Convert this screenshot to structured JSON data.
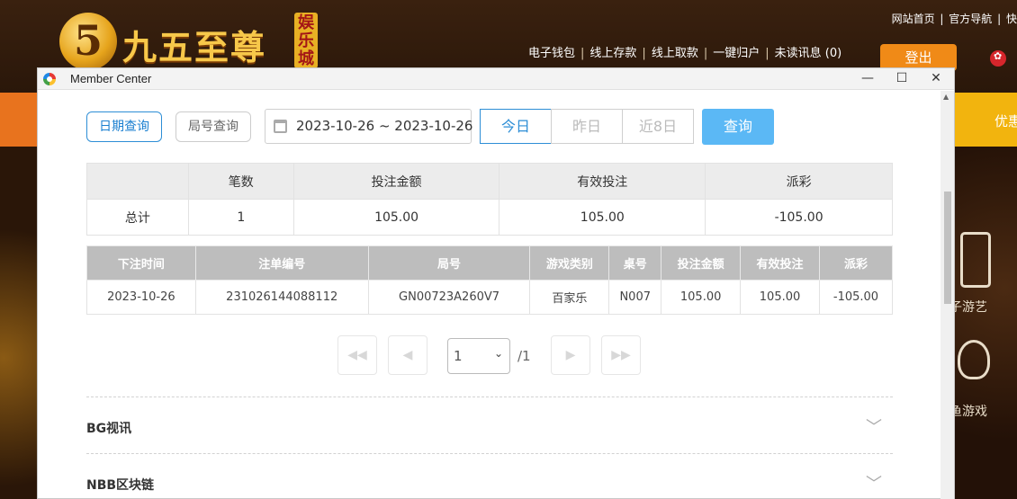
{
  "site": {
    "logo_number": "5",
    "logo_title": "九五至尊",
    "logo_badge": "娱乐城",
    "top_links": [
      "网站首页",
      "官方导航",
      "快"
    ],
    "nav_links": [
      "电子钱包",
      "线上存款",
      "线上取款",
      "一键归户",
      "未读讯息 (0)"
    ],
    "login_label": "登出",
    "band_right_text": "优惠",
    "side_labels": [
      "子游艺",
      "鱼游戏"
    ]
  },
  "window": {
    "title": "Member Center",
    "minimize": "—",
    "maximize": "☐",
    "close": "✕"
  },
  "filters": {
    "date_query": "日期查询",
    "round_query": "局号查询",
    "date_range": "2023-10-26 ~ 2023-10-26",
    "today": "今日",
    "yesterday": "昨日",
    "last8": "近8日",
    "search": "查询"
  },
  "summary": {
    "headers": [
      "",
      "笔数",
      "投注金额",
      "有效投注",
      "派彩"
    ],
    "row": [
      "总计",
      "1",
      "105.00",
      "105.00",
      "-105.00"
    ]
  },
  "detail": {
    "headers": [
      "下注时间",
      "注单编号",
      "局号",
      "游戏类别",
      "桌号",
      "投注金额",
      "有效投注",
      "派彩"
    ],
    "rows": [
      [
        "2023-10-26",
        "231026144088112",
        "GN00723A260V7",
        "百家乐",
        "N007",
        "105.00",
        "105.00",
        "-105.00"
      ]
    ]
  },
  "pagination": {
    "first": "◀◀",
    "prev": "◀",
    "current": "1",
    "total": "/1",
    "next": "▶",
    "last": "▶▶"
  },
  "accordions": [
    {
      "title": "BG视讯",
      "chevron": "﹀"
    },
    {
      "title": "NBB区块链",
      "chevron": "﹀"
    }
  ],
  "colors": {
    "accent": "#2d8ed6",
    "search_button": "#5bb8f5",
    "negative": "#e53935",
    "site_orange": "#e8731e"
  }
}
